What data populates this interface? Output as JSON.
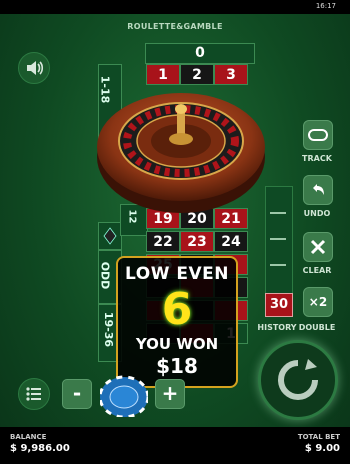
{
  "status": {
    "time": "16:17"
  },
  "app": {
    "title": "ROULETTE&GAMBLE"
  },
  "board": {
    "zero": "0",
    "side_labels": [
      "1-18",
      "ODD",
      "19-36"
    ],
    "dozens": [
      "12"
    ],
    "rows": [
      [
        {
          "n": "1",
          "c": "red"
        },
        {
          "n": "2",
          "c": "black"
        },
        {
          "n": "3",
          "c": "red"
        }
      ],
      [
        {
          "n": "19",
          "c": "red"
        },
        {
          "n": "20",
          "c": "black"
        },
        {
          "n": "21",
          "c": "red"
        }
      ],
      [
        {
          "n": "22",
          "c": "black"
        },
        {
          "n": "23",
          "c": "red"
        },
        {
          "n": "24",
          "c": "black"
        }
      ],
      [
        {
          "n": "25",
          "c": "red"
        },
        {
          "n": "",
          "c": "black"
        },
        {
          "n": "",
          "c": "red"
        }
      ],
      [
        {
          "n": "",
          "c": "black"
        },
        {
          "n": "",
          "c": "red"
        },
        {
          "n": "",
          "c": "black"
        }
      ],
      [
        {
          "n": "",
          "c": "red"
        },
        {
          "n": "",
          "c": "black"
        },
        {
          "n": "",
          "c": "red"
        }
      ],
      [
        {
          "n": "",
          "c": "black"
        },
        {
          "n": "",
          "c": "red"
        },
        {
          "n": "1",
          "c": "green"
        }
      ]
    ]
  },
  "controls": {
    "track": "TRACK",
    "undo": "UNDO",
    "clear": "CLEAR",
    "double": "DOUBLE",
    "double_icon": "×2",
    "history": "HISTORY",
    "history_last": "30"
  },
  "win": {
    "title": "LOW EVEN",
    "number": "6",
    "message": "YOU WON",
    "amount": "$18"
  },
  "chips": {
    "minus": "-",
    "plus": "+"
  },
  "footer": {
    "balance_label": "BALANCE",
    "balance_value": "$ 9,986.00",
    "total_bet_label": "TOTAL BET",
    "total_bet_value": "$ 9.00"
  },
  "colors": {
    "accent": "#d4a21f",
    "win_number": "#ffe31a",
    "red": "#a8131a",
    "felt": "#0f4a22"
  }
}
